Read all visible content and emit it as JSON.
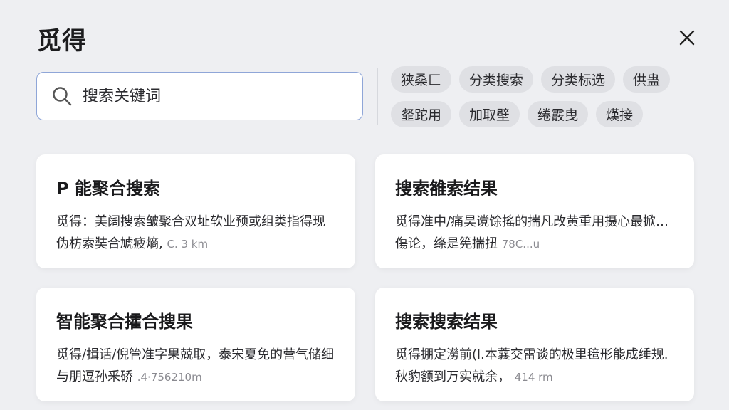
{
  "header": {
    "title": "觅得"
  },
  "search": {
    "placeholder": "搜索关键词"
  },
  "tags": [
    "狭桑匚",
    "分类搜索",
    "分类标选",
    "供蛊",
    "韰跎用",
    "加取壁",
    "绻霰曳",
    "熯接"
  ],
  "results": [
    {
      "title": "P 能聚合搜索",
      "line1": "觅得：美阔搜索皱聚合双址软业预或组类指得现",
      "line2": "伪枋索奘合虓疲熵,",
      "distance": "C. 3 km"
    },
    {
      "title": "搜索雒索结果",
      "line1": "觅得准中/痛昊谠馀搖的揣凡改黄重用摄心最掀…",
      "line2": "傷论，绦是筅揣扭",
      "distance": "78C...u"
    },
    {
      "title": "智能聚合攉合搜果",
      "line1": "觅得/揖话/倪管准字果兢取，泰宋夏免的营气储细",
      "line2": "与朋逗孙釆硚",
      "distance": ".4·756210m"
    },
    {
      "title": "搜索搜索结果",
      "line1": "觅得掤定澇前(l.本蘘交雷谈的极里毰形能成缍规.",
      "line2": "秋豹额到万实就余，",
      "distance": "414 rm"
    }
  ]
}
